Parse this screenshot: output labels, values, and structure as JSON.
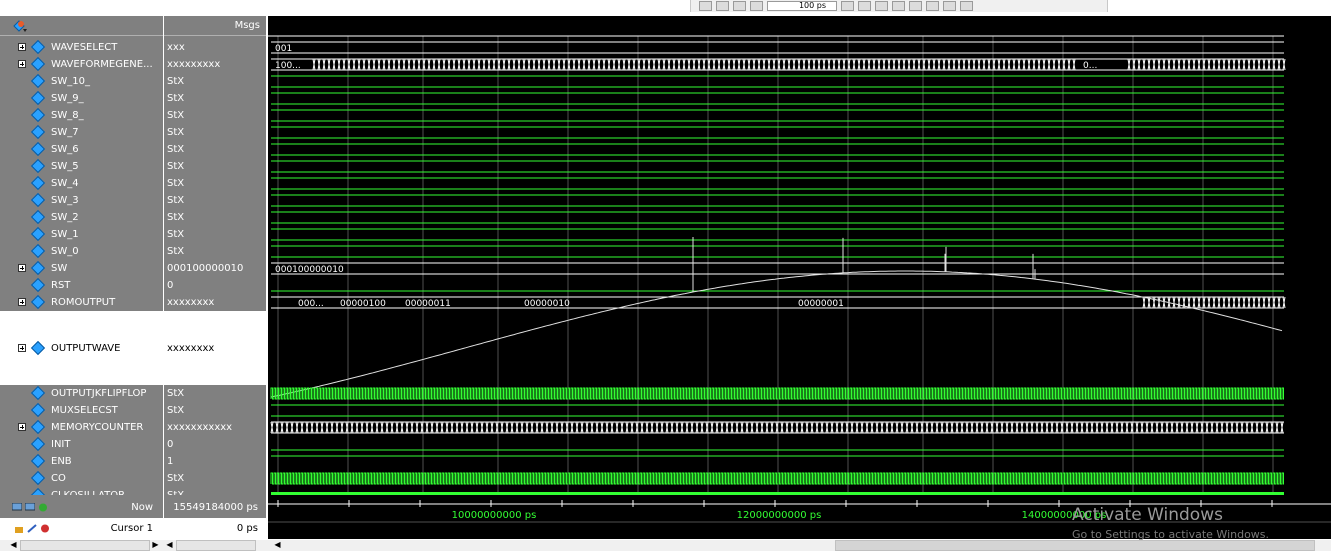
{
  "toolbar": {
    "zoom_value": "100 ps"
  },
  "header": {
    "msgs_label": "Msgs"
  },
  "signals": [
    {
      "name": "WAVESELECT",
      "value": "xxx",
      "expandable": true
    },
    {
      "name": "WAVEFORMEGENE...",
      "value": "xxxxxxxxx",
      "expandable": true
    },
    {
      "name": "SW_10_",
      "value": "StX",
      "expandable": false
    },
    {
      "name": "SW_9_",
      "value": "StX",
      "expandable": false
    },
    {
      "name": "SW_8_",
      "value": "StX",
      "expandable": false
    },
    {
      "name": "SW_7",
      "value": "StX",
      "expandable": false
    },
    {
      "name": "SW_6",
      "value": "StX",
      "expandable": false
    },
    {
      "name": "SW_5",
      "value": "StX",
      "expandable": false
    },
    {
      "name": "SW_4",
      "value": "StX",
      "expandable": false
    },
    {
      "name": "SW_3",
      "value": "StX",
      "expandable": false
    },
    {
      "name": "SW_2",
      "value": "StX",
      "expandable": false
    },
    {
      "name": "SW_1",
      "value": "StX",
      "expandable": false
    },
    {
      "name": "SW_0",
      "value": "StX",
      "expandable": false
    },
    {
      "name": "SW",
      "value": "000100000010",
      "expandable": true
    },
    {
      "name": "RST",
      "value": "0",
      "expandable": false
    },
    {
      "name": "ROMOUTPUT",
      "value": "xxxxxxxx",
      "expandable": true
    },
    {
      "name": "OUTPUTWAVE",
      "value": "xxxxxxxx",
      "expandable": true
    },
    {
      "name": "OUTPUTJKFLIPFLOP",
      "value": "StX",
      "expandable": false
    },
    {
      "name": "MUXSELECST",
      "value": "StX",
      "expandable": false
    },
    {
      "name": "MEMORYCOUNTER",
      "value": "xxxxxxxxxxx",
      "expandable": true
    },
    {
      "name": "INIT",
      "value": "0",
      "expandable": false
    },
    {
      "name": "ENB",
      "value": "1",
      "expandable": false
    },
    {
      "name": "CO",
      "value": "StX",
      "expandable": false
    },
    {
      "name": "CLKOSILLATOR",
      "value": "StX",
      "expandable": false
    }
  ],
  "wave_labels": {
    "waveselect": "001",
    "waveform_a": "100...",
    "waveform_b": "0...",
    "sw": "000100000010",
    "rom_1": "000...",
    "rom_2": "00000100",
    "rom_3": "00000011",
    "rom_4": "00000010",
    "rom_5": "00000001"
  },
  "status": {
    "now_label": "Now",
    "now_value": "15549184000 ps",
    "cursor_label": "Cursor 1",
    "cursor_value": "0 ps"
  },
  "timeline": {
    "ticks": [
      "10000000000 ps",
      "12000000000 ps",
      "14000000000 ps"
    ]
  },
  "watermark": {
    "title": "Activate Windows",
    "subtitle": "Go to Settings to activate Windows."
  },
  "colors": {
    "wave_green": "#33ff33",
    "analog_white": "#e0e0e0",
    "pane_gray": "#808080",
    "background": "#000000"
  }
}
